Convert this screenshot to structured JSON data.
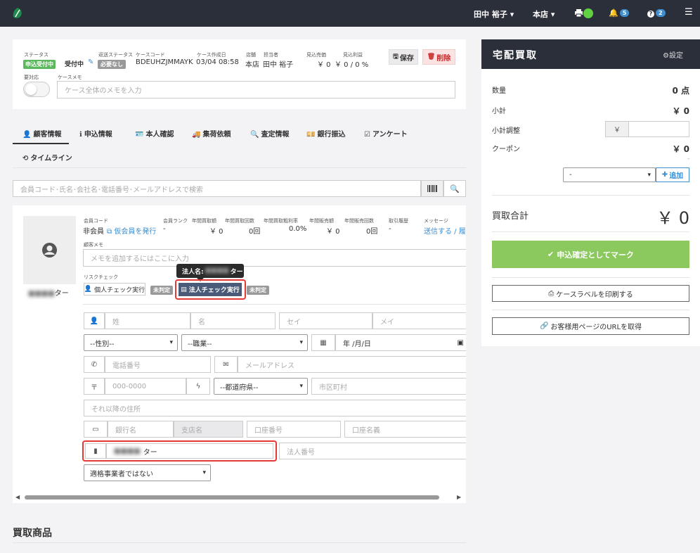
{
  "topbar": {
    "user": "田中 裕子",
    "store": "本店",
    "notif_count": "5",
    "help_count": "2",
    "caret": "▾"
  },
  "case": {
    "status_label": "ステータス",
    "status_badge": "申込受付中",
    "status_text": "受付中",
    "shipping_label": "返送ステータス",
    "shipping_badge": "必要なし",
    "code_label": "ケースコード",
    "code": "BDEUHZJMMAYK",
    "created_label": "ケース作成日",
    "created": "03/04 08:58",
    "store_label": "店舗",
    "store": "本店",
    "staff_label": "担当者",
    "staff": "田中 裕子",
    "est_sales_label": "見込売価",
    "est_sales": "￥ 0",
    "est_profit_label": "見込利益",
    "est_profit": "￥ 0 / 0 %",
    "save": "保存",
    "delete": "削除",
    "attention_label": "要対応",
    "memo_label": "ケースメモ",
    "memo_placeholder": "ケース全体のメモを入力"
  },
  "tabs": [
    {
      "label": "顧客情報",
      "icon": "👤"
    },
    {
      "label": "申込情報",
      "icon": "ℹ"
    },
    {
      "label": "本人確認",
      "icon": "🪪"
    },
    {
      "label": "集荷依頼",
      "icon": "🚚"
    },
    {
      "label": "査定情報",
      "icon": "🔍"
    },
    {
      "label": "銀行振込",
      "icon": "💴"
    },
    {
      "label": "アンケート",
      "icon": "☑"
    },
    {
      "label": "タイムライン",
      "icon": "⟲"
    }
  ],
  "search": {
    "placeholder": "会員コード･氏名･会社名･電話番号･メールアドレスで検索"
  },
  "customer": {
    "member_code_label": "会員コード",
    "member_code": "非会員",
    "issue_temp": "仮会員を発行",
    "rank_label": "会員ランク",
    "rank": "-",
    "annual_amount_label": "年間買取額",
    "annual_amount": "￥ 0",
    "annual_count_label": "年間買取回数",
    "annual_count": "0回",
    "gross_margin_label": "年間買取粗利率",
    "gross_margin": "0.0%",
    "sales_amount_label": "年間販売額",
    "sales_amount": "￥ 0",
    "sales_count_label": "年間販売回数",
    "sales_count": "0回",
    "history_label": "取引履歴",
    "history": "-",
    "message_label": "メッセージ",
    "message": "送信する / 履",
    "memo_label": "顧客メモ",
    "memo_placeholder": "メモを追加するにはここに入力",
    "risk_label": "リスクチェック",
    "personal_check": "個人チェック実行",
    "undetermined": "未判定",
    "corp_check": "法人チェック実行",
    "tooltip_prefix": "法人名:",
    "tooltip_suffix": "ター",
    "name_suffix": "ター",
    "last_name": "姓",
    "first_name": "名",
    "last_kana": "セイ",
    "first_kana": "メイ",
    "gender": "--性別--",
    "job": "--職業--",
    "date": "年 /月/日",
    "phone": "電話番号",
    "email": "メールアドレス",
    "postal": "000-0000",
    "prefecture": "--都道府県--",
    "city": "市区町村",
    "address": "それ以降の住所",
    "bank": "銀行名",
    "branch": "支店名",
    "account_no": "口座番号",
    "account_name": "口座名義",
    "corp_name_suffix": "ター",
    "corp_number": "法人番号",
    "invoice": "適格事業者ではない"
  },
  "products": {
    "title": "買取商品"
  },
  "right": {
    "title": "宅配買取",
    "settings": "設定",
    "qty_label": "数量",
    "qty": "0 点",
    "subtotal_label": "小計",
    "subtotal": "￥ 0",
    "adjust_label": "小計調整",
    "yen": "￥",
    "coupon_label": "クーポン",
    "coupon": "￥ 0",
    "coupon_dash": "-",
    "coupon_select": "-",
    "add": "追加",
    "total_label": "買取合計",
    "total": "￥ 0",
    "confirm": "申込確定としてマーク",
    "print_label": "ケースラベルを印刷する",
    "get_url": "お客様用ページのURLを取得"
  },
  "colors": {
    "green": "#8bc95f",
    "dark": "#2b2f3a",
    "red": "#e53935",
    "blue": "#3e8ed0"
  }
}
